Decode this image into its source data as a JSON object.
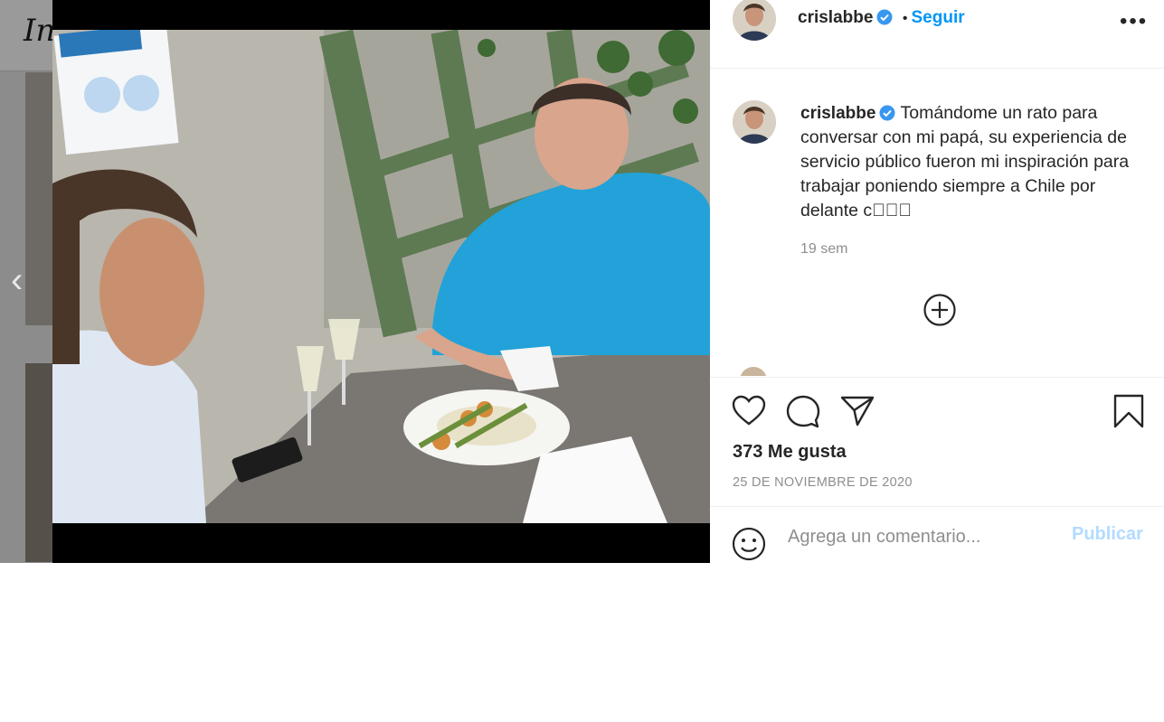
{
  "background": {
    "logo_fragment": "In",
    "prev_glyph": "‹"
  },
  "post": {
    "photo_icon": "photo",
    "author": {
      "username": "crislabbe",
      "verified_icon": "verified-badge-icon"
    },
    "header": {
      "separator": "•",
      "follow_label": "Seguir",
      "more_icon": "more-options-icon",
      "more_glyph": "•••"
    },
    "caption": {
      "username": "crislabbe",
      "text": "Tomándome un rato para conversar con mi papá, su experiencia de servicio público fueron mi inspiración para trabajar poniendo siempre a Chile por delante c\u0000\u0000\u0000"
    },
    "time_ago": "19 sem",
    "load_more_icon": "plus-circle-icon",
    "actions": {
      "like_icon": "heart-icon",
      "comment_icon": "comment-icon",
      "share_icon": "send-icon",
      "save_icon": "bookmark-icon"
    },
    "likes_text": "373 Me gusta",
    "date": "25 DE NOVIEMBRE DE 2020",
    "comment": {
      "emoji_icon": "emoji-icon",
      "placeholder": "Agrega un comentario...",
      "value": "",
      "publish_label": "Publicar"
    }
  },
  "colors": {
    "link_blue": "#0095f6",
    "publish_disabled": "#b3dbff",
    "verified_blue": "#3897f0",
    "muted_text": "#8e8e8e",
    "text": "#262626"
  }
}
